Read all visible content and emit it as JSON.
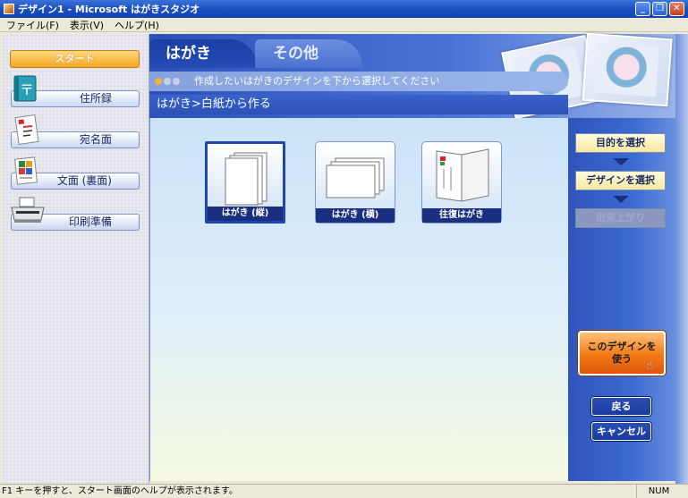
{
  "window": {
    "title": "デザイン1 - Microsoft はがきスタジオ",
    "controls": [
      "minimize-icon",
      "restore-icon",
      "close-icon"
    ]
  },
  "menu": [
    {
      "label": "ファイル(F)"
    },
    {
      "label": "表示(V)"
    },
    {
      "label": "ヘルプ(H)"
    }
  ],
  "sidebar": {
    "start_label": "スタート",
    "items": [
      {
        "label": "住所録",
        "icon": "address-book-icon"
      },
      {
        "label": "宛名面",
        "icon": "address-card-icon"
      },
      {
        "label": "文面 (裏面)",
        "icon": "design-page-icon"
      },
      {
        "label": "印刷準備",
        "icon": "printer-icon"
      }
    ]
  },
  "tabs": [
    {
      "label": "はがき",
      "active": true
    },
    {
      "label": "その他",
      "active": false
    }
  ],
  "instruction": "作成したいはがきのデザインを下から選択してください",
  "breadcrumb": "はがき>白紙から作る",
  "cards": [
    {
      "label": "はがき (縦)",
      "selected": true
    },
    {
      "label": "はがき (横)",
      "selected": false
    },
    {
      "label": "往復はがき",
      "selected": false
    }
  ],
  "steps": [
    {
      "label": "目的を選択",
      "state": "done"
    },
    {
      "label": "デザインを選択",
      "state": "current"
    },
    {
      "label": "出来上がり",
      "state": "disabled"
    }
  ],
  "actions": {
    "use_design_line1": "このデザインを",
    "use_design_line2": "使う",
    "back": "戻る",
    "cancel": "キャンセル"
  },
  "status": {
    "text": "F1 キーを押すと、スタート画面のヘルプが表示されます。",
    "num": "NUM"
  },
  "colors": {
    "accent": "#2c51b8",
    "start_button": "#f6a621",
    "use_button": "#f27a14"
  }
}
